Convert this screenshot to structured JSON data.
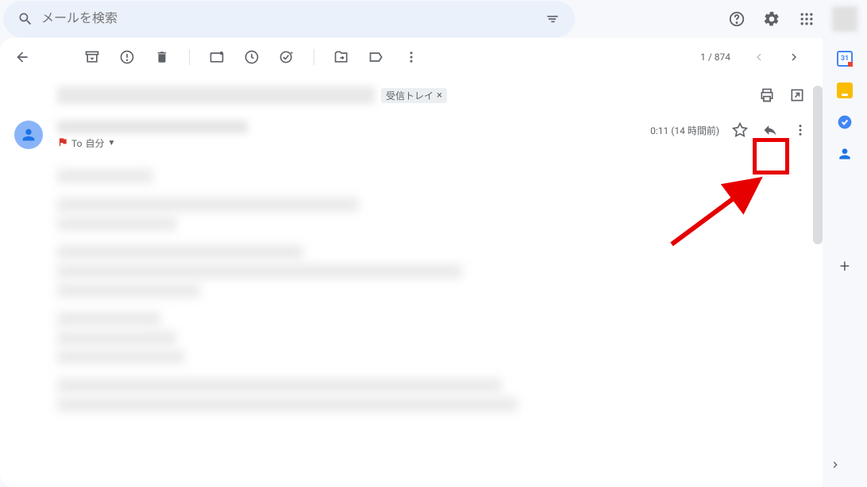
{
  "header": {
    "search_placeholder": "メールを検索"
  },
  "toolbar": {
    "pagination": "1 / 874"
  },
  "email": {
    "inbox_label": "受信トレイ",
    "to_prefix": "To",
    "to_recipient": "自分",
    "time": "0:11 (14 時間前)"
  },
  "sidepanel": {
    "calendar_badge": "31"
  }
}
